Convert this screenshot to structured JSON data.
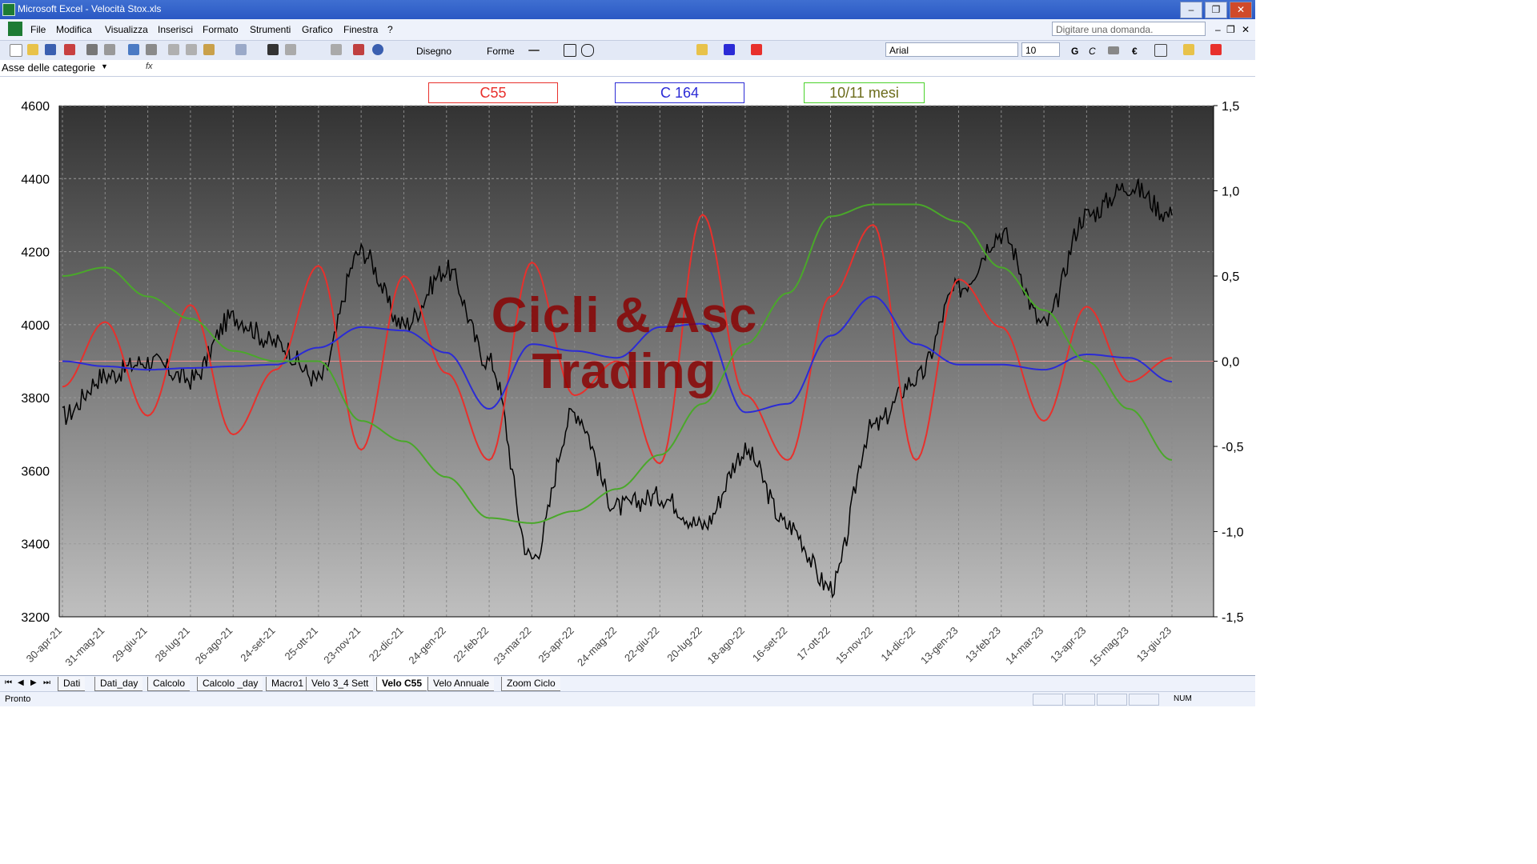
{
  "window": {
    "title": "Microsoft Excel - Velocità Stox.xls"
  },
  "menu": [
    "File",
    "Modifica",
    "Visualizza",
    "Inserisci",
    "Formato",
    "Strumenti",
    "Grafico",
    "Finestra",
    "?"
  ],
  "ask_placeholder": "Digitare una domanda.",
  "toolbar": {
    "disegno": "Disegno",
    "forme": "Forme",
    "font": "Arial",
    "size": "10"
  },
  "namebox": "Asse delle categorie",
  "legend": [
    {
      "label": "C55",
      "color": "#e8302c"
    },
    {
      "label": "C 164",
      "color": "#2b2bd6"
    },
    {
      "label": "10/11 mesi",
      "color": "#4aa82a"
    }
  ],
  "watermark": {
    "line1": "Cicli & Asc",
    "line2": "Trading"
  },
  "sheet_tabs": [
    "Dati",
    "Dati_day",
    "Calcolo",
    "Calcolo _day",
    "Macro1",
    "Velo 3_4 Sett",
    "Velo C55",
    "Velo Annuale",
    "Zoom Ciclo"
  ],
  "active_tab": "Velo C55",
  "status": {
    "text": "Pronto",
    "num": "NUM"
  },
  "chart_data": {
    "type": "line",
    "x": [
      "30-apr-21",
      "31-mag-21",
      "29-giu-21",
      "28-lug-21",
      "26-ago-21",
      "24-set-21",
      "25-ott-21",
      "23-nov-21",
      "22-dic-21",
      "24-gen-22",
      "22-feb-22",
      "23-mar-22",
      "25-apr-22",
      "24-mag-22",
      "22-giu-22",
      "20-lug-22",
      "18-ago-22",
      "16-set-22",
      "17-ott-22",
      "15-nov-22",
      "14-dic-22",
      "13-gen-23",
      "13-feb-23",
      "14-mar-23",
      "13-apr-23",
      "15-mag-23",
      "13-giu-23"
    ],
    "left_axis": {
      "ticks": [
        "4600",
        "4400",
        "4200",
        "4000",
        "3800",
        "3600",
        "3400",
        "3200"
      ],
      "ylim": [
        3200,
        4600
      ]
    },
    "right_axis": {
      "ticks": [
        "1,5",
        "1,0",
        "0,5",
        "0,0",
        "-0,5",
        "-1,0",
        "-1,5"
      ],
      "ylim": [
        -1.5,
        1.5
      ]
    },
    "series": [
      {
        "name": "",
        "axis": "left",
        "color": "#000000",
        "values": [
          3750,
          3860,
          3900,
          3850,
          4020,
          3950,
          3850,
          4200,
          4000,
          4150,
          3900,
          3360,
          3760,
          3500,
          3530,
          3450,
          3650,
          3450,
          3280,
          3720,
          3850,
          4100,
          4250,
          4000,
          4300,
          4380,
          4300
        ]
      },
      {
        "name": "C55",
        "axis": "right",
        "color": "#e8302c",
        "values": [
          -0.15,
          0.23,
          -0.32,
          0.33,
          -0.43,
          -0.05,
          0.56,
          -0.52,
          0.5,
          -0.07,
          -0.58,
          0.58,
          -0.2,
          0.0,
          -0.6,
          0.86,
          -0.2,
          -0.58,
          0.38,
          0.8,
          -0.58,
          0.48,
          0.2,
          -0.35,
          0.32,
          -0.12,
          0.02
        ]
      },
      {
        "name": "C 164",
        "axis": "right",
        "color": "#2b2bd6",
        "values": [
          0.0,
          -0.03,
          -0.05,
          -0.04,
          -0.03,
          -0.02,
          0.08,
          0.2,
          0.18,
          0.05,
          -0.28,
          0.1,
          0.06,
          0.02,
          0.2,
          0.22,
          -0.3,
          -0.25,
          0.15,
          0.38,
          0.1,
          -0.02,
          -0.02,
          -0.05,
          0.04,
          0.02,
          -0.12
        ]
      },
      {
        "name": "10/11 mesi",
        "axis": "right",
        "color": "#4aa82a",
        "values": [
          0.5,
          0.55,
          0.38,
          0.25,
          0.06,
          0.0,
          0.0,
          -0.35,
          -0.47,
          -0.68,
          -0.92,
          -0.95,
          -0.88,
          -0.75,
          -0.55,
          -0.25,
          0.1,
          0.4,
          0.85,
          0.92,
          0.92,
          0.82,
          0.55,
          0.3,
          0.0,
          -0.28,
          -0.58
        ]
      }
    ],
    "grid": true,
    "background": "gradient dark grey to light grey"
  }
}
